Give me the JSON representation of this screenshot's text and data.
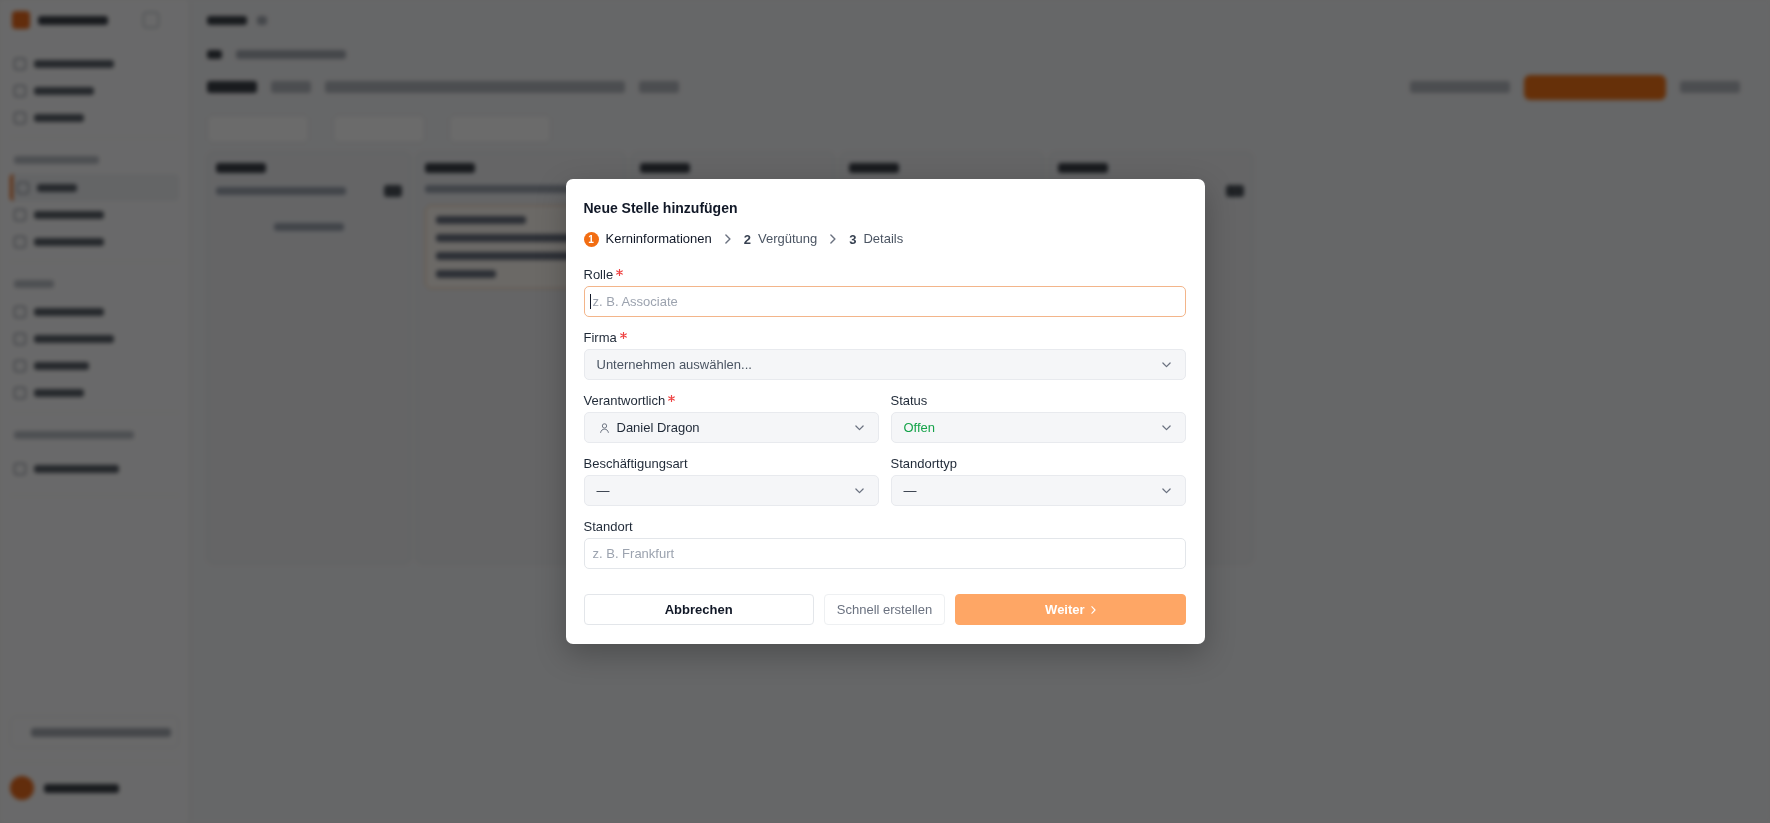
{
  "dialog": {
    "title": "Neue Stelle hinzufügen",
    "steps": [
      {
        "number": "1",
        "label": "Kerninformationen",
        "selected": true
      },
      {
        "number": "2",
        "label": "Vergütung",
        "selected": false
      },
      {
        "number": "3",
        "label": "Details",
        "selected": false
      }
    ],
    "rows": [
      {
        "fields": [
          {
            "kind": "text",
            "label": "Rolle",
            "required": true,
            "placeholder": "z. B. Associate",
            "focused": true
          }
        ]
      },
      {
        "fields": [
          {
            "kind": "select",
            "label": "Firma",
            "required": true,
            "placeholder": "Unternehmen auswählen..."
          }
        ]
      },
      {
        "fields": [
          {
            "kind": "user-select",
            "label": "Verantwortlich",
            "required": true,
            "value": "Daniel Dragon"
          },
          {
            "kind": "select",
            "label": "Status",
            "required": false,
            "value": "Offen",
            "color": "#16a34a"
          }
        ]
      },
      {
        "fields": [
          {
            "kind": "select",
            "label": "Beschäftigungsart",
            "required": false,
            "value": "—"
          },
          {
            "kind": "select",
            "label": "Standorttyp",
            "required": false,
            "value": "—"
          }
        ]
      },
      {
        "fields": [
          {
            "kind": "text",
            "label": "Standort",
            "required": false,
            "placeholder": "z. B. Frankfurt",
            "focused": false
          }
        ]
      }
    ],
    "buttons": [
      {
        "kind": "secondary",
        "label": "Abbrechen"
      },
      {
        "kind": "ghost",
        "label": "Schnell erstellen"
      },
      {
        "kind": "primary",
        "label": "Weiter",
        "disabled": true
      }
    ]
  }
}
